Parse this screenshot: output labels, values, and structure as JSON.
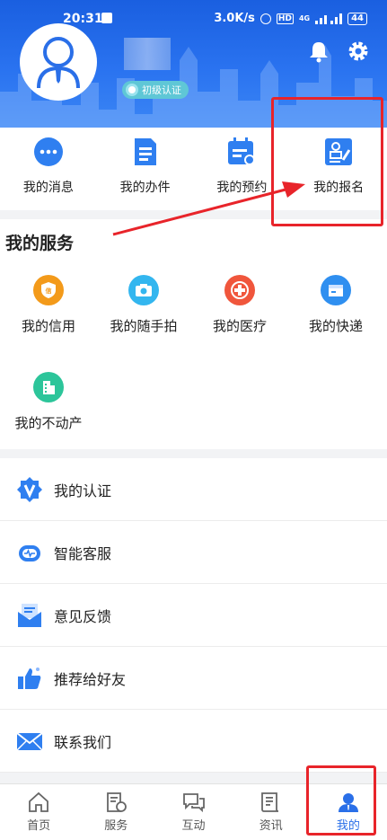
{
  "status_bar": {
    "time": "20:31",
    "speed": "3.0K/s",
    "hd": "HD",
    "signal": "4G",
    "battery": "44"
  },
  "profile": {
    "badge": "初级认证"
  },
  "quick_actions": [
    {
      "label": "我的消息",
      "icon": "chat-icon"
    },
    {
      "label": "我的办件",
      "icon": "document-icon"
    },
    {
      "label": "我的预约",
      "icon": "calendar-icon"
    },
    {
      "label": "我的报名",
      "icon": "signup-icon"
    }
  ],
  "services": {
    "title": "我的服务",
    "items": [
      {
        "label": "我的信用",
        "icon": "shield-icon",
        "color": "#f39a1a"
      },
      {
        "label": "我的随手拍",
        "icon": "camera-icon",
        "color": "#33b6ef"
      },
      {
        "label": "我的医疗",
        "icon": "medical-icon",
        "color": "#f0563c"
      },
      {
        "label": "我的快递",
        "icon": "package-icon",
        "color": "#2f8ff0"
      },
      {
        "label": "我的不动产",
        "icon": "building-icon",
        "color": "#2cc59a"
      }
    ]
  },
  "menu": [
    {
      "label": "我的认证",
      "icon": "verify-icon"
    },
    {
      "label": "智能客服",
      "icon": "robot-icon"
    },
    {
      "label": "意见反馈",
      "icon": "mail-open-icon"
    },
    {
      "label": "推荐给好友",
      "icon": "thumbs-up-icon"
    },
    {
      "label": "联系我们",
      "icon": "envelope-icon"
    }
  ],
  "bottom_nav": [
    {
      "label": "首页",
      "icon": "home-icon"
    },
    {
      "label": "服务",
      "icon": "service-icon"
    },
    {
      "label": "互动",
      "icon": "interact-icon"
    },
    {
      "label": "资讯",
      "icon": "news-icon"
    },
    {
      "label": "我的",
      "icon": "profile-icon",
      "active": true
    }
  ],
  "colors": {
    "primary": "#2a6fe8",
    "highlight": "#e8242a"
  }
}
